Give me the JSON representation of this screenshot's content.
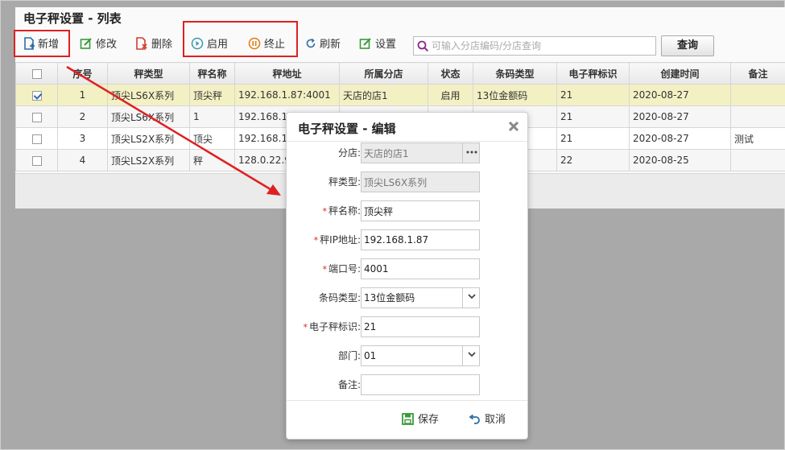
{
  "list": {
    "title": "电子秤设置 - 列表",
    "toolbar": {
      "add": "新增",
      "edit": "修改",
      "delete": "删除",
      "enable": "启用",
      "disable": "终止",
      "refresh": "刷新",
      "settings": "设置",
      "search_placeholder": "可输入分店编码/分店查询",
      "query": "查询"
    },
    "columns": [
      "序号",
      "秤类型",
      "秤名称",
      "秤地址",
      "所属分店",
      "状态",
      "条码类型",
      "电子秤标识",
      "创建时间",
      "备注"
    ],
    "rows": [
      {
        "checked": true,
        "no": "1",
        "type": "顶尖LS6X系列",
        "name": "顶尖秤",
        "address": "192.168.1.87:4001",
        "store": "天店的店1",
        "status": "启用",
        "barcode": "13位金额码",
        "id": "21",
        "created": "2020-08-27",
        "note": ""
      },
      {
        "checked": false,
        "no": "2",
        "type": "顶尖LS6X系列",
        "name": "1",
        "address": "192.168.1.",
        "store": "",
        "status": "",
        "barcode": "",
        "id": "21",
        "created": "2020-08-27",
        "note": ""
      },
      {
        "checked": false,
        "no": "3",
        "type": "顶尖LS2X系列",
        "name": "顶尖",
        "address": "192.168.1.",
        "store": "",
        "status": "",
        "barcode": "",
        "id": "21",
        "created": "2020-08-27",
        "note": "测试"
      },
      {
        "checked": false,
        "no": "4",
        "type": "顶尖LS2X系列",
        "name": "秤",
        "address": "128.0.22.9",
        "store": "",
        "status": "",
        "barcode": "",
        "id": "22",
        "created": "2020-08-25",
        "note": ""
      }
    ]
  },
  "dialog": {
    "title": "电子秤设置 - 编辑",
    "fields": {
      "store": {
        "label": "分店:",
        "value": "天店的店1"
      },
      "type": {
        "label": "秤类型:",
        "value": "顶尖LS6X系列"
      },
      "name": {
        "label": "秤名称:",
        "value": "顶尖秤"
      },
      "ip": {
        "label": "秤IP地址:",
        "value": "192.168.1.87"
      },
      "port": {
        "label": "端口号:",
        "value": "4001"
      },
      "barcode": {
        "label": "条码类型:",
        "value": "13位金额码"
      },
      "scale_id": {
        "label": "电子秤标识:",
        "value": "21"
      },
      "dept": {
        "label": "部门:",
        "value": "01"
      },
      "note": {
        "label": "备注:",
        "value": ""
      }
    },
    "required_mark": "*",
    "save": "保存",
    "cancel": "取消"
  },
  "colors": {
    "highlight": "#e02020",
    "selected_row": "#f3f0c4",
    "icon_blue": "#2d6ca2",
    "icon_green": "#3a9a3a",
    "icon_red": "#d0402f",
    "icon_orange": "#e07a10"
  }
}
